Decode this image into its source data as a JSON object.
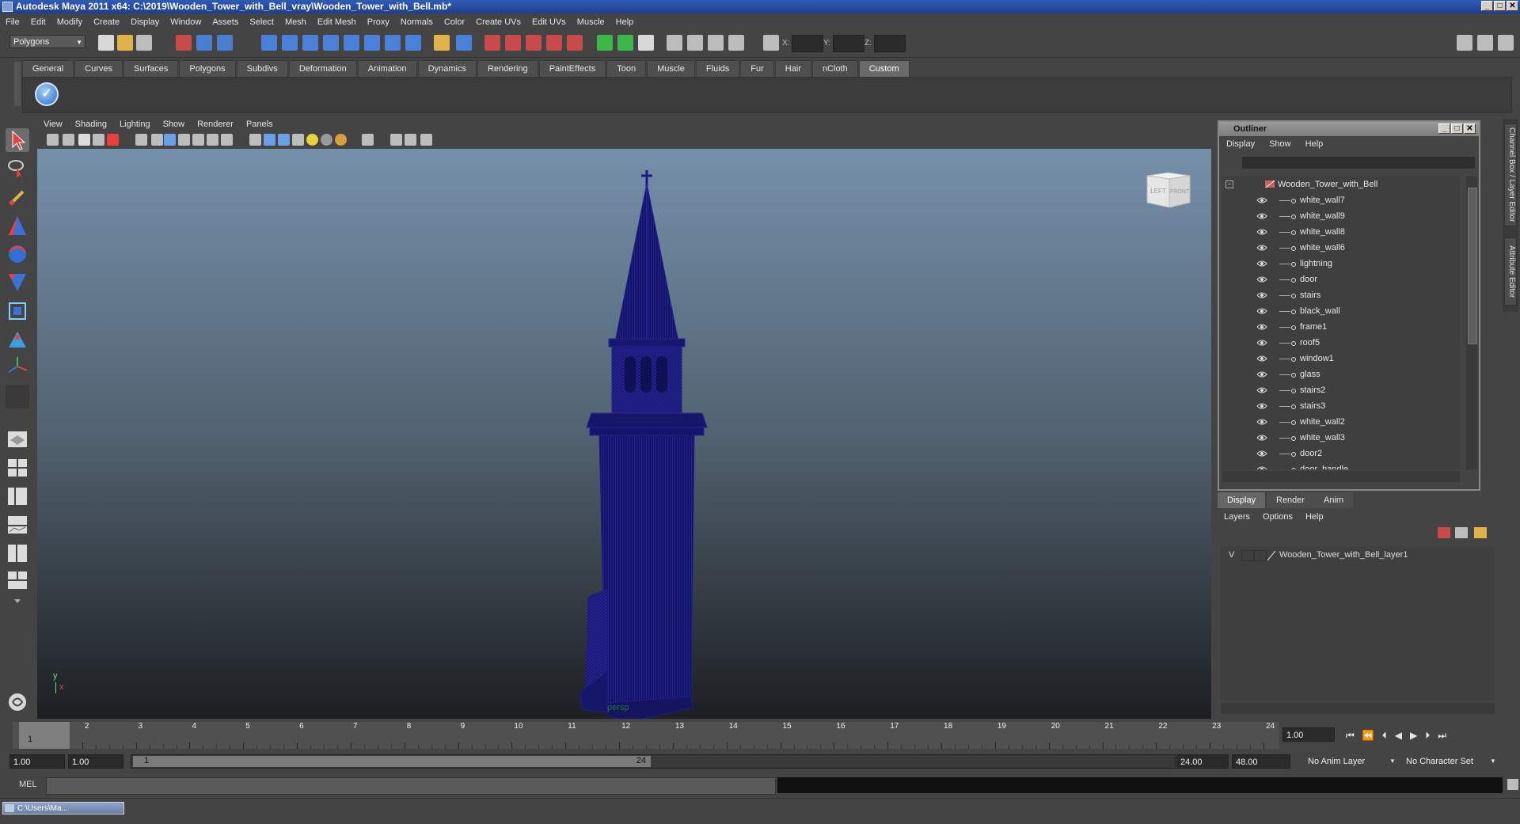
{
  "window": {
    "title": "Autodesk Maya 2011 x64: C:\\2019\\Wooden_Tower_with_Bell_vray\\Wooden_Tower_with_Bell.mb*",
    "buttons": [
      "_",
      "□",
      "✕"
    ]
  },
  "menubar": [
    "File",
    "Edit",
    "Modify",
    "Create",
    "Display",
    "Window",
    "Assets",
    "Select",
    "Mesh",
    "Edit Mesh",
    "Proxy",
    "Normals",
    "Color",
    "Create UVs",
    "Edit UVs",
    "Muscle",
    "Help"
  ],
  "status": {
    "mode": "Polygons",
    "x_label": "X:",
    "y_label": "Y:",
    "z_label": "Z:"
  },
  "shelf": {
    "tabs": [
      "General",
      "Curves",
      "Surfaces",
      "Polygons",
      "Subdivs",
      "Deformation",
      "Animation",
      "Dynamics",
      "Rendering",
      "PaintEffects",
      "Toon",
      "Muscle",
      "Fluids",
      "Fur",
      "Hair",
      "nCloth",
      "Custom"
    ],
    "active_tab": "Custom",
    "button_glyph": "✓"
  },
  "viewport": {
    "menus": [
      "View",
      "Shading",
      "Lighting",
      "Show",
      "Renderer",
      "Panels"
    ],
    "camera_label": "persp",
    "axis_y": "y",
    "axis_x": "x",
    "viewcube_left": "LEFT",
    "viewcube_front": "FRONT",
    "model_color": "#16166e"
  },
  "outliner": {
    "title": "Outliner",
    "menus": [
      "Display",
      "Show",
      "Help"
    ],
    "root": "Wooden_Tower_with_Bell",
    "items": [
      "white_wall7",
      "white_wall9",
      "white_wall8",
      "white_wall6",
      "lightning",
      "door",
      "stairs",
      "black_wall",
      "frame1",
      "roof5",
      "window1",
      "glass",
      "stairs2",
      "stairs3",
      "white_wall2",
      "white_wall3",
      "door2",
      "door_handle"
    ]
  },
  "side_tabs": [
    "Channel Box / Layer Editor",
    "Attribute Editor"
  ],
  "layer_editor": {
    "tabs": [
      "Display",
      "Render",
      "Anim"
    ],
    "active_tab": "Display",
    "menus": [
      "Layers",
      "Options",
      "Help"
    ],
    "visibility": "V",
    "layer_name": "Wooden_Tower_with_Bell_layer1"
  },
  "timeline": {
    "frames": [
      "1",
      "2",
      "3",
      "4",
      "5",
      "6",
      "7",
      "8",
      "9",
      "10",
      "11",
      "12",
      "13",
      "14",
      "15",
      "16",
      "17",
      "18",
      "19",
      "20",
      "21",
      "22",
      "23",
      "24"
    ],
    "current_marker": "1",
    "current_frame": "1.00"
  },
  "range": {
    "start": "1.00",
    "playback_start": "1.00",
    "slider_start": "1",
    "slider_end": "24",
    "playback_end": "24.00",
    "end": "48.00",
    "anim_layer": "No Anim Layer",
    "character_set": "No Character Set"
  },
  "command": {
    "label": "MEL"
  },
  "taskbar": {
    "item": "C:\\Users\\Ma..."
  }
}
